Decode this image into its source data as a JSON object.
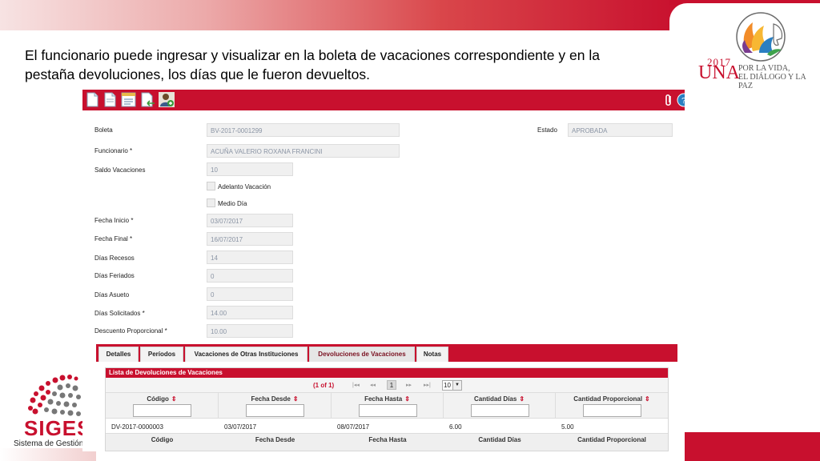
{
  "slide": {
    "title_line1": "El funcionario puede ingresar y visualizar en la boleta de vacaciones correspondiente y en la",
    "title_line2": "pestaña devoluciones, los días que le fueron devueltos."
  },
  "logos": {
    "una_year": "2017",
    "una_name": "UNA",
    "una_motto_1": "POR LA VIDA,",
    "una_motto_2": "EL DIÁLOGO Y LA PAZ",
    "siges_name": "SIGES",
    "siges_subtitle": "Sistema de Gestión Ac"
  },
  "toolbar": {
    "icons": [
      "new-document-icon",
      "document-icon",
      "list-document-icon",
      "document-return-icon",
      "user-add-icon"
    ],
    "right_icons": [
      "paperclip-icon",
      "help-icon"
    ]
  },
  "form": {
    "boleta_label": "Boleta",
    "boleta_value": "BV-2017-0001299",
    "estado_label": "Estado",
    "estado_value": "APROBADA",
    "funcionario_label": "Funcionario  *",
    "funcionario_value": "ACUÑA  VALERIO ROXANA FRANCINI",
    "saldo_label": "Saldo Vacaciones",
    "saldo_value": "10",
    "adelanto_label": "Adelanto Vacación",
    "medio_dia_label": "Medio Día",
    "fecha_inicio_label": "Fecha Inicio  *",
    "fecha_inicio_value": "03/07/2017",
    "fecha_final_label": "Fecha Final  *",
    "fecha_final_value": "16/07/2017",
    "dias_recesos_label": "Días Recesos",
    "dias_recesos_value": "14",
    "dias_feriados_label": "Días Feriados",
    "dias_feriados_value": "0",
    "dias_asueto_label": "Días Asueto",
    "dias_asueto_value": "0",
    "dias_solicitados_label": "Días Solicitados  *",
    "dias_solicitados_value": "14.00",
    "descuento_label": "Descuento Proporcional  *",
    "descuento_value": "10.00"
  },
  "tabs": [
    {
      "label": "Detalles"
    },
    {
      "label": "Períodos"
    },
    {
      "label": "Vacaciones de Otras Instituciones"
    },
    {
      "label": "Devoluciones de Vacaciones"
    },
    {
      "label": "Notas"
    }
  ],
  "grid": {
    "title": "Lista de Devoluciones de Vacaciones",
    "pager_count": "(1 of 1)",
    "pager_first": "|◂◂",
    "pager_prev": "◂◂",
    "pager_page": "1",
    "pager_next": "▸▸",
    "pager_last": "▸▸|",
    "rows_per_page": "10",
    "columns": [
      "Código",
      "Fecha Desde",
      "Fecha Hasta",
      "Cantidad Días",
      "Cantidad Proporcional"
    ],
    "sort_glyph": "⇕",
    "rows": [
      [
        "DV-2017-0000003",
        "03/07/2017",
        "08/07/2017",
        "6.00",
        "5.00"
      ]
    ]
  },
  "colors": {
    "accent": "#c8102e"
  }
}
